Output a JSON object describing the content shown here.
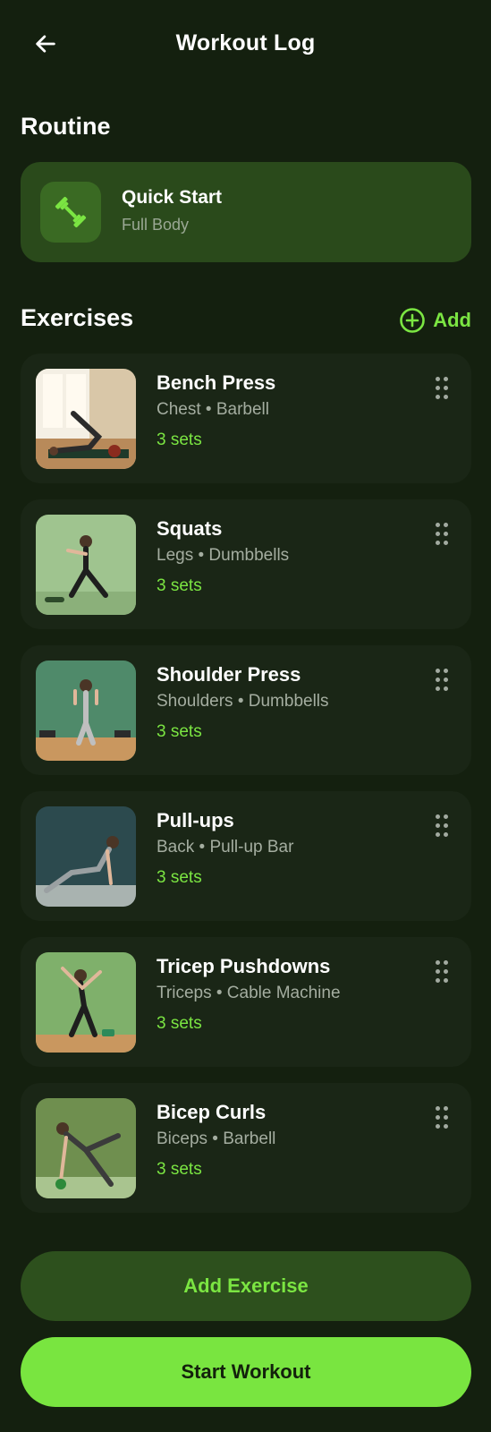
{
  "header": {
    "title": "Workout Log",
    "back_icon": "arrow-left-icon"
  },
  "routine": {
    "section_title": "Routine",
    "card": {
      "name": "Quick Start",
      "subtitle": "Full Body",
      "icon": "dumbbell-icon"
    }
  },
  "exercises": {
    "section_title": "Exercises",
    "add_label": "Add",
    "add_icon": "plus-circle-icon",
    "items": [
      {
        "name": "Bench Press",
        "meta": "Chest • Barbell",
        "sets": "3 sets"
      },
      {
        "name": "Squats",
        "meta": "Legs • Dumbbells",
        "sets": "3 sets"
      },
      {
        "name": "Shoulder Press",
        "meta": "Shoulders • Dumbbells",
        "sets": "3 sets"
      },
      {
        "name": "Pull-ups",
        "meta": "Back • Pull-up Bar",
        "sets": "3 sets"
      },
      {
        "name": "Tricep Pushdowns",
        "meta": "Triceps • Cable Machine",
        "sets": "3 sets"
      },
      {
        "name": "Bicep Curls",
        "meta": "Biceps • Barbell",
        "sets": "3 sets"
      }
    ]
  },
  "actions": {
    "add_exercise": "Add Exercise",
    "start_workout": "Start Workout"
  },
  "colors": {
    "accent": "#79e540",
    "background": "#14200f",
    "card": "#1a2616",
    "routine_card": "#2a4a1b"
  }
}
